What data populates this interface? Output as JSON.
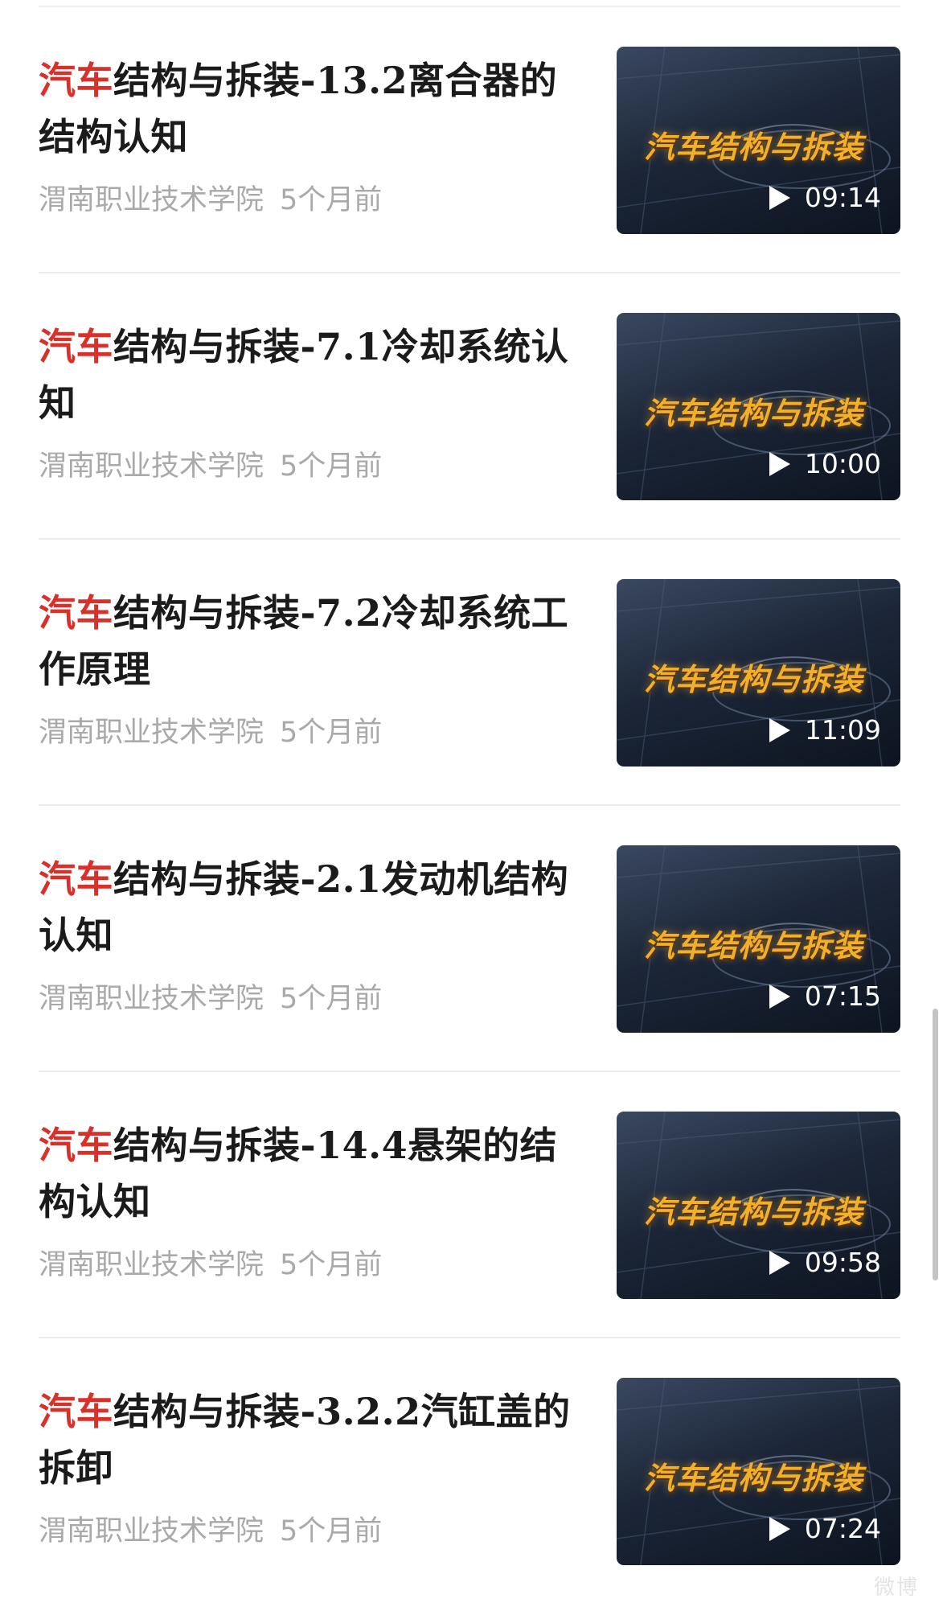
{
  "highlight_color": "#d9302a",
  "items": [
    {
      "title_highlight": "汽车",
      "title_rest": "结构与拆装-13.2离合器的结构认知",
      "source": "渭南职业技术学院",
      "time": "5个月前",
      "thumb_logo": "汽车结构与拆装",
      "duration": "09:14"
    },
    {
      "title_highlight": "汽车",
      "title_rest": "结构与拆装-7.1冷却系统认知",
      "source": "渭南职业技术学院",
      "time": "5个月前",
      "thumb_logo": "汽车结构与拆装",
      "duration": "10:00"
    },
    {
      "title_highlight": "汽车",
      "title_rest": "结构与拆装-7.2冷却系统工作原理",
      "source": "渭南职业技术学院",
      "time": "5个月前",
      "thumb_logo": "汽车结构与拆装",
      "duration": "11:09"
    },
    {
      "title_highlight": "汽车",
      "title_rest": "结构与拆装-2.1发动机结构认知",
      "source": "渭南职业技术学院",
      "time": "5个月前",
      "thumb_logo": "汽车结构与拆装",
      "duration": "07:15"
    },
    {
      "title_highlight": "汽车",
      "title_rest": "结构与拆装-14.4悬架的结构认知",
      "source": "渭南职业技术学院",
      "time": "5个月前",
      "thumb_logo": "汽车结构与拆装",
      "duration": "09:58"
    },
    {
      "title_highlight": "汽车",
      "title_rest": "结构与拆装-3.2.2汽缸盖的拆卸",
      "source": "渭南职业技术学院",
      "time": "5个月前",
      "thumb_logo": "汽车结构与拆装",
      "duration": "07:24"
    }
  ],
  "watermark": "微博"
}
